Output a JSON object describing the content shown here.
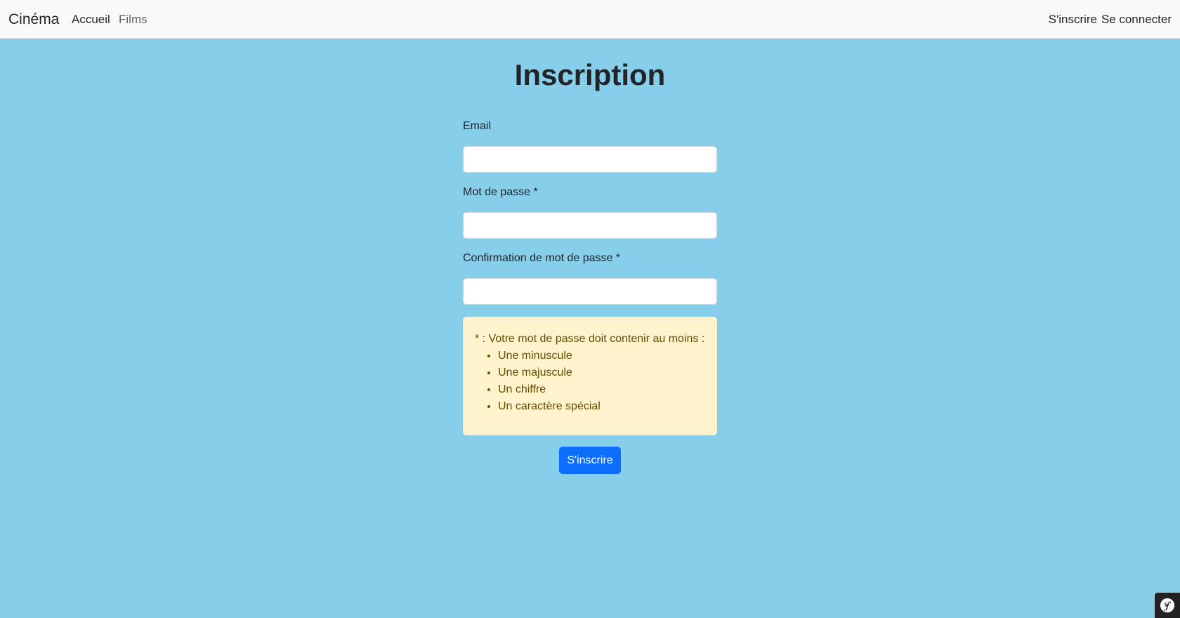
{
  "navbar": {
    "brand": "Cinéma",
    "links": [
      {
        "label": "Accueil"
      },
      {
        "label": "Films"
      }
    ],
    "right_links": [
      {
        "label": "S'inscrire"
      },
      {
        "label": "Se connecter"
      }
    ]
  },
  "page": {
    "title": "Inscription"
  },
  "form": {
    "email_label": "Email",
    "email_value": "",
    "password_label": "Mot de passe *",
    "password_value": "",
    "confirm_label": "Confirmation de mot de passe *",
    "confirm_value": "",
    "hint": {
      "intro": "* : Votre mot de passe doit contenir au moins :",
      "items": [
        "Une minuscule",
        "Une majuscule",
        "Un chiffre",
        "Un caractère spécial"
      ]
    },
    "submit_label": "S'inscrire"
  },
  "debug_toolbar": {
    "icon": "symfony-logo-icon"
  },
  "colors": {
    "background": "#87ceeb",
    "navbar": "#f8f9fa",
    "primary": "#0d6efd",
    "warning_bg": "#fff3cd",
    "warning_text": "#664d03"
  }
}
